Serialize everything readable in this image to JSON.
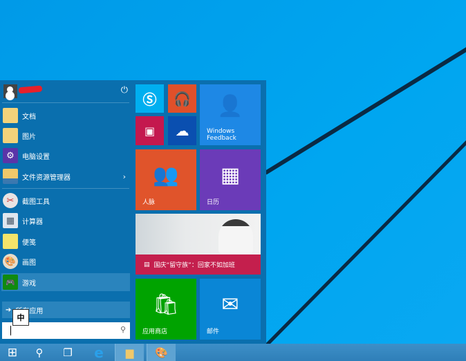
{
  "user": {
    "name_redacted": true
  },
  "left_menu": {
    "power_icon": "power-icon",
    "items": [
      {
        "label": "文档",
        "icon": "documents-folder-icon"
      },
      {
        "label": "图片",
        "icon": "pictures-folder-icon"
      },
      {
        "label": "电脑设置",
        "icon": "settings-gear-icon"
      },
      {
        "label": "文件资源管理器",
        "icon": "file-explorer-icon",
        "has_submenu": true
      },
      {
        "label": "截图工具",
        "icon": "snipping-tool-icon"
      },
      {
        "label": "计算器",
        "icon": "calculator-icon"
      },
      {
        "label": "便笺",
        "icon": "sticky-notes-icon"
      },
      {
        "label": "画图",
        "icon": "paint-icon"
      },
      {
        "label": "游戏",
        "icon": "xbox-games-icon",
        "selected": true
      }
    ],
    "all_apps": "所有应用",
    "ime_indicator": "中",
    "search_value": ""
  },
  "tiles": {
    "skype": {
      "color": "#00aff0"
    },
    "music": {
      "color": "#e0502a"
    },
    "video": {
      "color": "#c4184e"
    },
    "onedrive": {
      "color": "#0a4fb0"
    },
    "feedback": {
      "label": "Windows Feedback",
      "color": "#1e88e5"
    },
    "people": {
      "label": "人脉",
      "color": "#e0542b"
    },
    "calendar": {
      "label": "日历",
      "color": "#6b3bb8"
    },
    "news": {
      "headline": "国庆“留守族”：回家不如加班",
      "color": "#c41f4d"
    },
    "store": {
      "label": "应用商店",
      "color": "#00a300"
    },
    "mail": {
      "label": "邮件",
      "color": "#0a86d6"
    }
  },
  "taskbar": {
    "items": [
      "start",
      "search",
      "task-view",
      "internet-explorer",
      "file-explorer",
      "paint"
    ],
    "active": [
      "file-explorer",
      "paint"
    ]
  }
}
